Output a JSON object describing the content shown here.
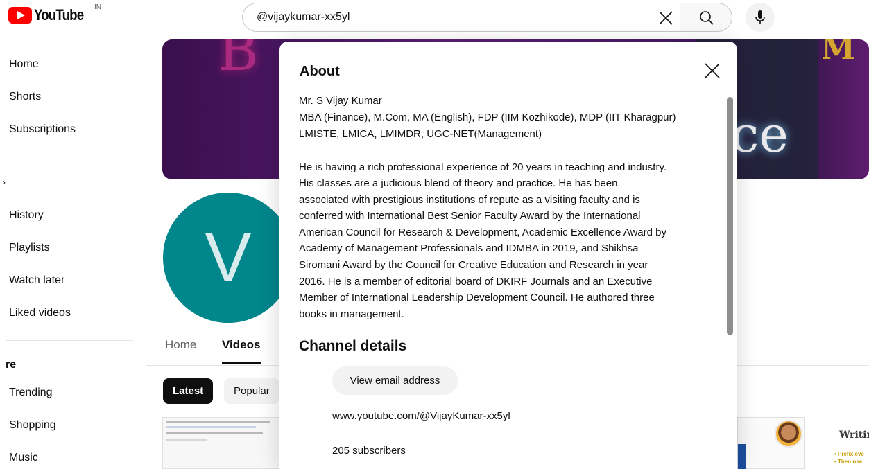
{
  "header": {
    "logo_text": "YouTube",
    "region": "IN",
    "search_value": "@vijaykumar-xx5yl"
  },
  "sidebar": {
    "items_top": [
      {
        "label": "Home"
      },
      {
        "label": "Shorts"
      },
      {
        "label": "Subscriptions"
      }
    ],
    "chevron": "›",
    "items_you": [
      {
        "label": "History"
      },
      {
        "label": "Playlists"
      },
      {
        "label": "Watch later"
      },
      {
        "label": "Liked videos"
      }
    ],
    "section_explore": "re",
    "items_explore": [
      {
        "label": "Trending"
      },
      {
        "label": "Shopping"
      },
      {
        "label": "Music"
      }
    ]
  },
  "channel": {
    "avatar_letter": "V",
    "tabs": [
      {
        "label": "Home"
      },
      {
        "label": "Videos"
      }
    ],
    "chips": [
      {
        "label": "Latest"
      },
      {
        "label": "Popular"
      }
    ],
    "thumb_title_partial": "Writir",
    "thumb_line1": "• Prefix eve",
    "thumb_line2": "• Then use"
  },
  "about_modal": {
    "title": "About",
    "description_lines": [
      "Mr. S Vijay Kumar",
      "MBA (Finance), M.Com, MA (English), FDP (IIM Kozhikode), MDP (IIT Kharagpur)",
      "LMISTE, LMICA, LMIMDR, UGC-NET(Management)",
      "",
      "He is having a rich professional experience of 20 years in teaching and industry.",
      "His classes are a judicious blend of theory and practice. He has been",
      "associated with prestigious institutions of repute as a visiting faculty and is",
      "conferred with International Best Senior Faculty Award by the International",
      "American Council for Research & Development, Academic Excellence Award by",
      "Academy of Management Professionals and IDMBA in 2019, and Shikhsa",
      "Siromani Award by the Council for Creative Education and Research in year",
      "2016. He is a member of editorial board of DKIRF Journals and an Executive",
      "Member of International Leadership Development Council. He authored three",
      "books in management."
    ],
    "details_title": "Channel details",
    "email_button": "View email address",
    "channel_url": "www.youtube.com/@VijayKumar-xx5yl",
    "subscribers": "205 subscribers"
  }
}
